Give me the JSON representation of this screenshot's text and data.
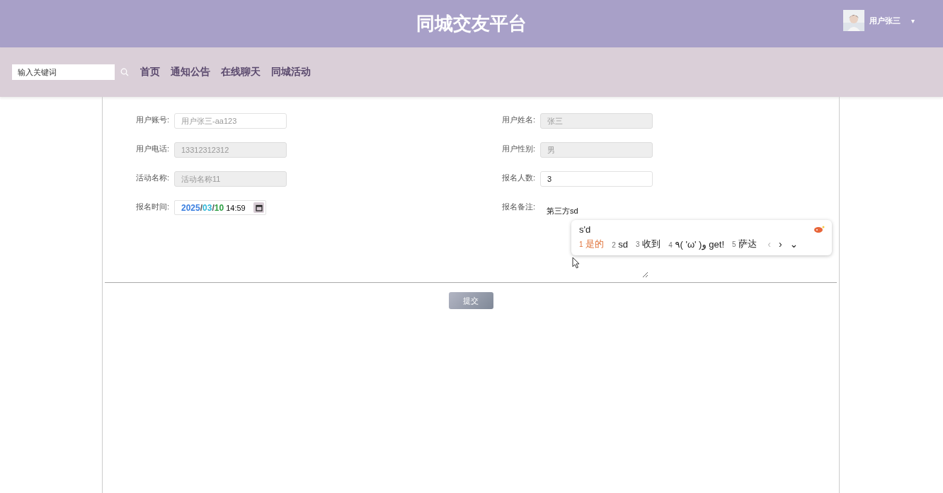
{
  "header": {
    "title": "同城交友平台",
    "user": {
      "name": "用户张三",
      "menu_caret": "▾"
    }
  },
  "nav": {
    "search": {
      "placeholder": "输入关键词"
    },
    "links": [
      {
        "label": "首页"
      },
      {
        "label": "通知公告"
      },
      {
        "label": "在线聊天"
      },
      {
        "label": "同城活动"
      }
    ]
  },
  "form": {
    "fields": [
      {
        "kind": "text",
        "label": "用户账号:",
        "placeholder": "用户张三-aa123",
        "disabled": false
      },
      {
        "kind": "text",
        "label": "用户姓名:",
        "value": "张三",
        "disabled": true
      },
      {
        "kind": "text",
        "label": "用户电话:",
        "value": "13312312312",
        "disabled": true
      },
      {
        "kind": "text",
        "label": "用户性别:",
        "value": "男",
        "disabled": true
      },
      {
        "kind": "text",
        "label": "活动名称:",
        "value": "活动名称11",
        "disabled": true
      },
      {
        "kind": "text",
        "label": "报名人数:",
        "value": "3",
        "disabled": false
      },
      {
        "kind": "date",
        "label": "报名时间:",
        "parts": [
          {
            "text": "2025",
            "color": "#3b7fe0"
          },
          {
            "text": "/"
          },
          {
            "text": "03",
            "color": "#2fb7d8"
          },
          {
            "text": "/"
          },
          {
            "text": "10",
            "color": "#2ea043"
          }
        ],
        "time": "14:59"
      },
      {
        "kind": "textarea",
        "label": "报名备注:",
        "value": "第三方sd"
      }
    ],
    "submit": "提交"
  },
  "ime": {
    "composition": "s'd",
    "candidates": [
      {
        "index": "1",
        "text": "是的",
        "selected": true
      },
      {
        "index": "2",
        "text": "sd",
        "selected": false
      },
      {
        "index": "3",
        "text": "收到",
        "selected": false
      },
      {
        "index": "4",
        "text": "٩( 'ω' )و get!",
        "selected": false
      },
      {
        "index": "5",
        "text": "萨达",
        "selected": false
      }
    ],
    "prev": "‹",
    "next": "›",
    "expand": "⌄"
  }
}
